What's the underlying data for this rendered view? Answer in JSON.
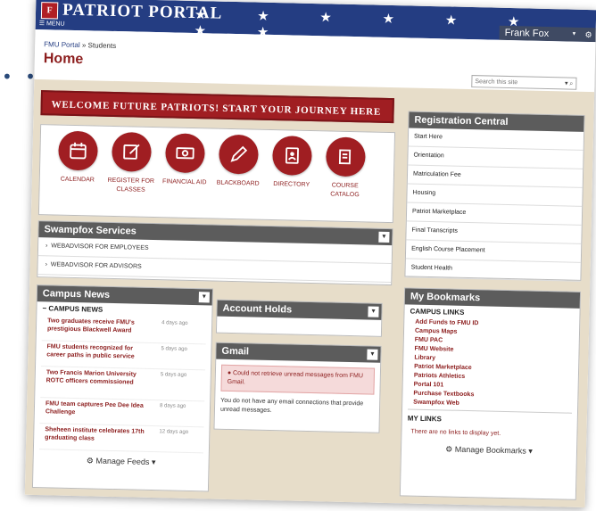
{
  "header": {
    "logo_letter": "F",
    "portal_title": "PATRIOT PORTAL",
    "stars": "★ ★ ★ ★ ★ ★ ★ ★",
    "menu_label": "MENU",
    "user_name": "Frank Fox",
    "user_caret": "▾",
    "gear_glyph": "⚙"
  },
  "breadcrumb": {
    "root": "FMU Portal",
    "separator": "»",
    "current": "Students"
  },
  "page_title": "Home",
  "search": {
    "placeholder": "Search this site",
    "icons": "▾ ⌕"
  },
  "banner": {
    "text": "WELCOME FUTURE PATRIOTS! START YOUR JOURNEY HERE ▶"
  },
  "quick_links": [
    {
      "label": "CALENDAR",
      "icon": "calendar-icon"
    },
    {
      "label": "REGISTER FOR CLASSES",
      "icon": "register-icon"
    },
    {
      "label": "FINANCIAL AID",
      "icon": "money-icon"
    },
    {
      "label": "BLACKBOARD",
      "icon": "pencil-icon"
    },
    {
      "label": "DIRECTORY",
      "icon": "directory-icon"
    },
    {
      "label": "COURSE CATALOG",
      "icon": "catalog-icon"
    }
  ],
  "swampfox": {
    "title": "Swampfox Services",
    "items": [
      "WEBADVISOR FOR EMPLOYEES",
      "WEBADVISOR FOR ADVISORS"
    ]
  },
  "registration": {
    "title": "Registration Central",
    "items": [
      "Start Here",
      "Orientation",
      "Matriculation Fee",
      "Housing",
      "Patriot Marketplace",
      "Final Transcripts",
      "English Course Placement",
      "Student Health"
    ]
  },
  "campus_news": {
    "title": "Campus News",
    "subtitle": "CAMPUS NEWS",
    "items": [
      {
        "title": "Two graduates receive FMU's prestigious Blackwell Award",
        "date": "4 days ago"
      },
      {
        "title": "FMU students recognized for career paths in public service",
        "date": "5 days ago"
      },
      {
        "title": "Two Francis Marion University ROTC officers commissioned",
        "date": "5 days ago"
      },
      {
        "title": "FMU team captures Pee Dee Idea Challenge",
        "date": "8 days ago"
      },
      {
        "title": "Sheheen institute celebrates 17th graduating class",
        "date": "12 days ago"
      }
    ],
    "footer": "Manage Feeds"
  },
  "account_holds": {
    "title": "Account Holds"
  },
  "gmail": {
    "title": "Gmail",
    "error": "Could not retrieve unread messages from FMU Gmail.",
    "note": "You do not have any email connections that provide unread messages."
  },
  "bookmarks": {
    "title": "My Bookmarks",
    "campus_heading": "CAMPUS LINKS",
    "campus_links": [
      "Add Funds to FMU ID",
      "Campus Maps",
      "FMU PAC",
      "FMU Website",
      "Library",
      "Patriot Marketplace",
      "Patriots Athletics",
      "Portal 101",
      "Purchase Textbooks",
      "Swampfox Web"
    ],
    "my_heading": "MY LINKS",
    "my_note": "There are no links to display yet.",
    "footer": "Manage Bookmarks"
  },
  "colors": {
    "navy": "#243d82",
    "maroon": "#a01e22",
    "panel_header": "#5c5c5c",
    "background": "#e7ddc9"
  }
}
